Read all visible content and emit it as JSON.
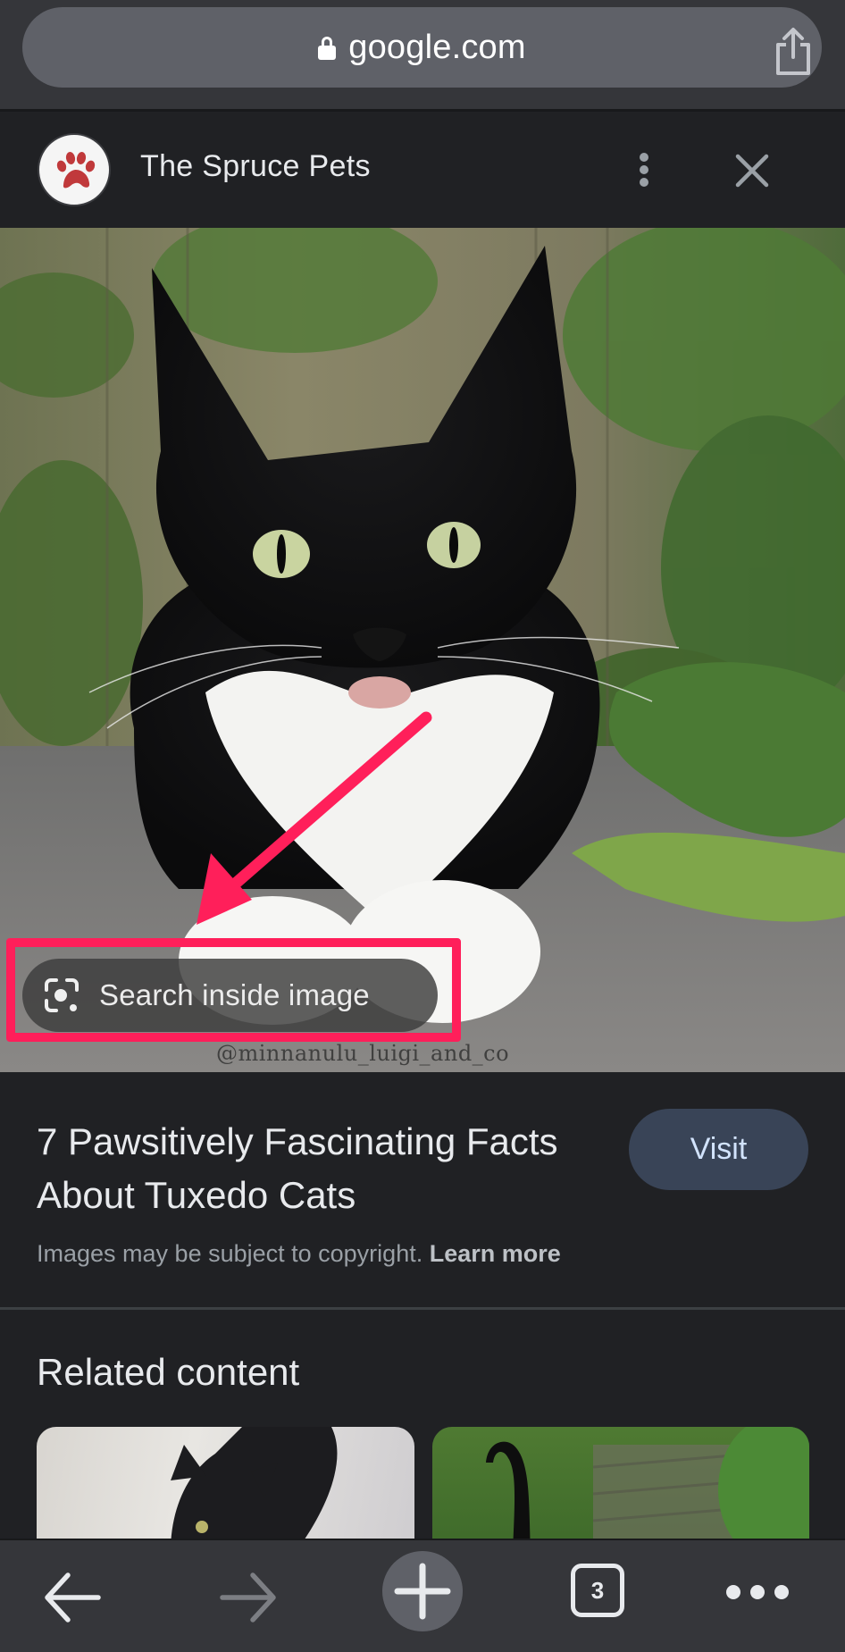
{
  "browser": {
    "url": "google.com",
    "secure": true,
    "icons": {
      "lock": "lock-icon",
      "share": "share-icon"
    }
  },
  "site_header": {
    "site_name": "The Spruce Pets",
    "logo_icon": "paw-icon",
    "logo_color": "#c0393b",
    "menu_icon": "more-vertical-icon",
    "close_icon": "close-icon"
  },
  "image_viewer": {
    "watermark": "@minnanulu_luigi_and_co",
    "lens_button_label": "Search inside image",
    "lens_icon": "google-lens-icon",
    "annotation": {
      "highlight_color": "#ff1f5a",
      "arrow_icon": "annotation-arrow"
    }
  },
  "result": {
    "title": "7 Pawsitively Fascinating Facts About Tuxedo Cats",
    "visit_label": "Visit",
    "copyright_text": "Images may be subject to copyright.",
    "learn_more_label": "Learn more"
  },
  "related": {
    "heading": "Related content",
    "cards": [
      {
        "description": "black cat on light background thumbnail"
      },
      {
        "description": "black cat tail in garden thumbnail"
      }
    ]
  },
  "toolbar": {
    "back_icon": "back-arrow-icon",
    "forward_icon": "forward-arrow-icon",
    "new_tab_icon": "plus-icon",
    "tab_count": "3",
    "more_icon": "more-horizontal-icon",
    "forward_enabled": false
  }
}
